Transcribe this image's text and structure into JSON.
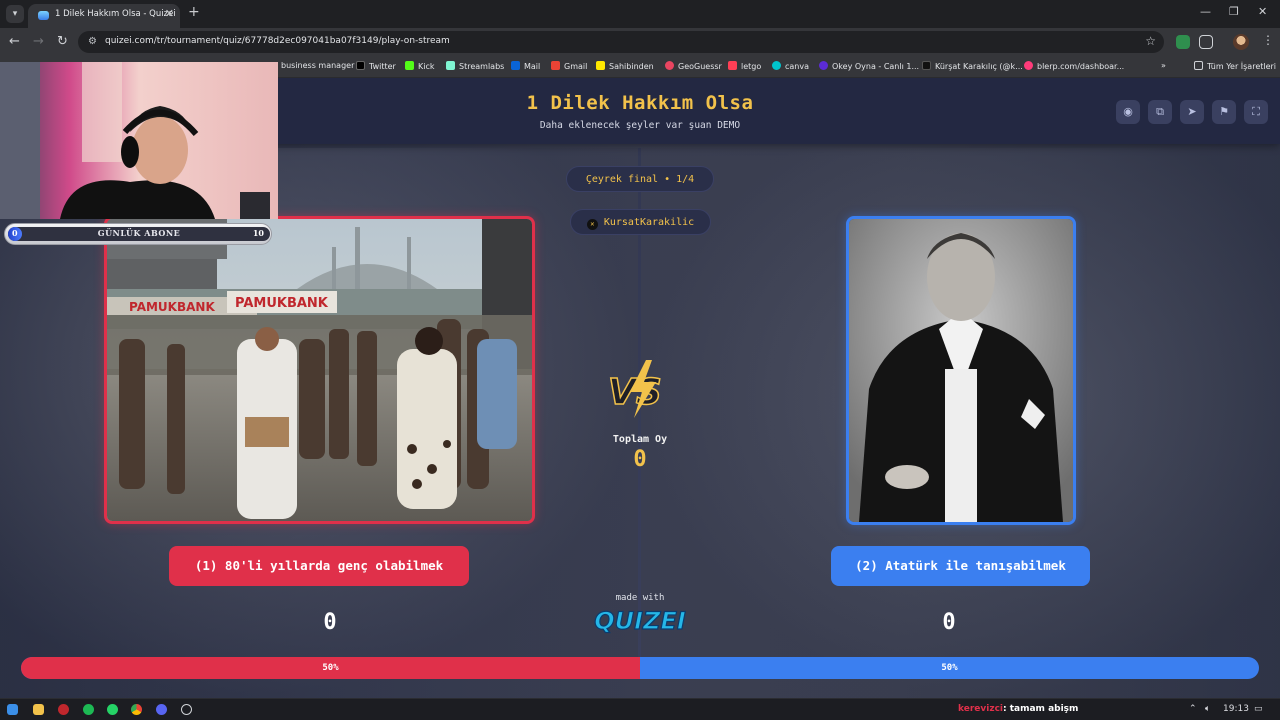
{
  "browser": {
    "tab_title": "1 Dilek Hakkım Olsa - Quizei",
    "url": "quizei.com/tr/tournament/quiz/67778d2ec097041ba07f3149/play-on-stream",
    "bookmarks": [
      {
        "label": "business manager",
        "color": "#1877f2"
      },
      {
        "label": "Twitter",
        "color": "#000000"
      },
      {
        "label": "Kick",
        "color": "#53fc18"
      },
      {
        "label": "Streamlabs",
        "color": "#80f5d2"
      },
      {
        "label": "Mail",
        "color": "#0a64d6"
      },
      {
        "label": "Gmail",
        "color": "#ea4335"
      },
      {
        "label": "Sahibinden",
        "color": "#ffe800"
      },
      {
        "label": "GeoGuessr",
        "color": "#e94560"
      },
      {
        "label": "letgo",
        "color": "#ff3f55"
      },
      {
        "label": "canva",
        "color": "#00c4cc"
      },
      {
        "label": "Okey Oyna - Canlı 1...",
        "color": "#5b2bd6"
      },
      {
        "label": "Kürşat Karakılıç (@k...",
        "color": "#111111"
      },
      {
        "label": "blerp.com/dashboar...",
        "color": "#ff3b7a"
      }
    ],
    "all_bookmarks": "Tüm Yer İşaretleri"
  },
  "header": {
    "title": "1 Dilek Hakkım Olsa",
    "subtitle": "Daha eklenecek şeyler var şuan DEMO"
  },
  "round": {
    "label": "Çeyrek final • 1/4",
    "username": "KursatKarakilic"
  },
  "total": {
    "label": "Toplam Oy",
    "value": "0"
  },
  "options": {
    "left": {
      "label": "(1) 80'li yıllarda genç olabilmek",
      "score": "0",
      "percent": "50%",
      "share": 0.5,
      "color": "#e0304a"
    },
    "right": {
      "label": "(2) Atatürk ile tanışabilmek",
      "score": "0",
      "percent": "50%",
      "share": 0.5,
      "color": "#3b7ff0"
    }
  },
  "footer": {
    "made_with": "made with",
    "brand": "QUIZEI"
  },
  "overlay": {
    "sub_goal_label": "GÜNLÜK ABONE",
    "sub_current": "0",
    "sub_target": "10",
    "sub_progress": 0.05
  },
  "taskbar": {
    "chat_nick": "kerevizci",
    "chat_message": ": tamam abişm",
    "time": "19:13"
  }
}
